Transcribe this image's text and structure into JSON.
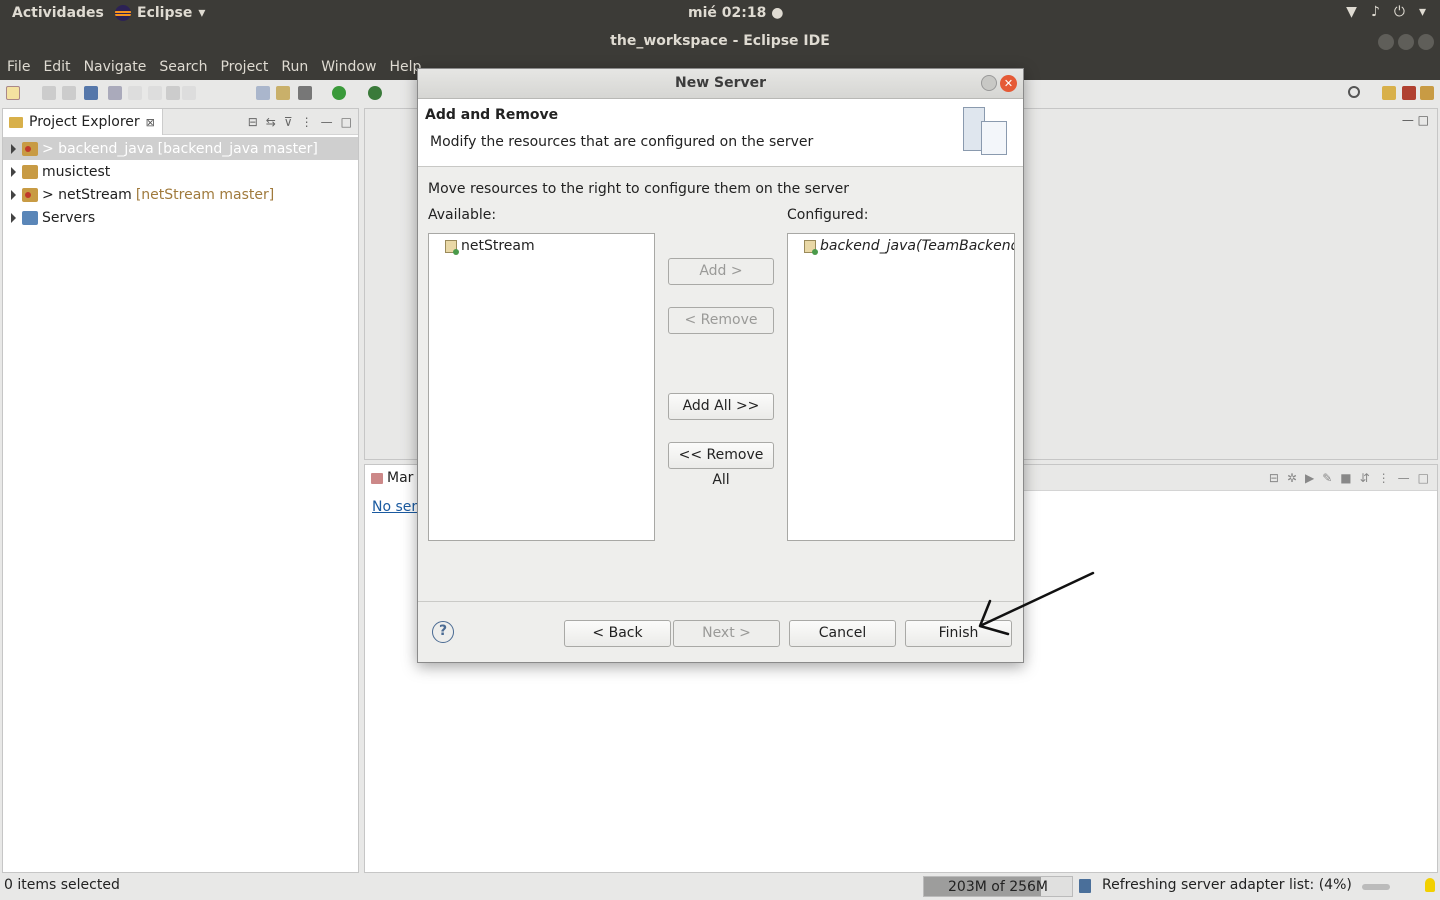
{
  "topbar": {
    "activities": "Actividades",
    "app": "Eclipse",
    "clock": "mié 02:18 ●"
  },
  "window": {
    "title": "the_workspace - Eclipse IDE"
  },
  "menu": {
    "items": [
      "File",
      "Edit",
      "Navigate",
      "Search",
      "Project",
      "Run",
      "Window",
      "Help"
    ]
  },
  "project_explorer": {
    "tab_label": "Project Explorer",
    "tree": [
      {
        "name": "> backend_java",
        "branch": "[backend_java master]",
        "selected": true,
        "git": true
      },
      {
        "name": "musictest",
        "branch": "",
        "selected": false,
        "git": false
      },
      {
        "name": "> netStream",
        "branch": "[netStream master]",
        "selected": false,
        "git": true
      },
      {
        "name": "Servers",
        "branch": "",
        "selected": false,
        "git": false
      }
    ]
  },
  "servers_view": {
    "tab_label": "Mar",
    "link": "No ser"
  },
  "dialog": {
    "title": "New Server",
    "header_title": "Add and Remove",
    "header_desc": "Modify the resources that are configured on the server",
    "instructions": "Move resources to the right to configure them on the server",
    "available_label": "Available:",
    "configured_label": "Configured:",
    "available_items": [
      "netStream"
    ],
    "configured_items": [
      "backend_java(TeamBackendJ"
    ],
    "buttons": {
      "add": "Add >",
      "remove": "< Remove",
      "add_all": "Add All >>",
      "remove_all": "<< Remove All",
      "back": "< Back",
      "next": "Next >",
      "cancel": "Cancel",
      "finish": "Finish"
    },
    "help": "?"
  },
  "statusbar": {
    "selection": "0 items selected",
    "heap": "203M of 256M",
    "heap_fraction": 0.79,
    "message": "Refreshing server adapter list: (4%)",
    "progress_fraction": 0.04
  },
  "colors": {
    "topbar_bg": "#3c3b37",
    "close_button": "#e55a36",
    "selection_bg": "#cfcfcf",
    "link": "#1a5aa0"
  }
}
